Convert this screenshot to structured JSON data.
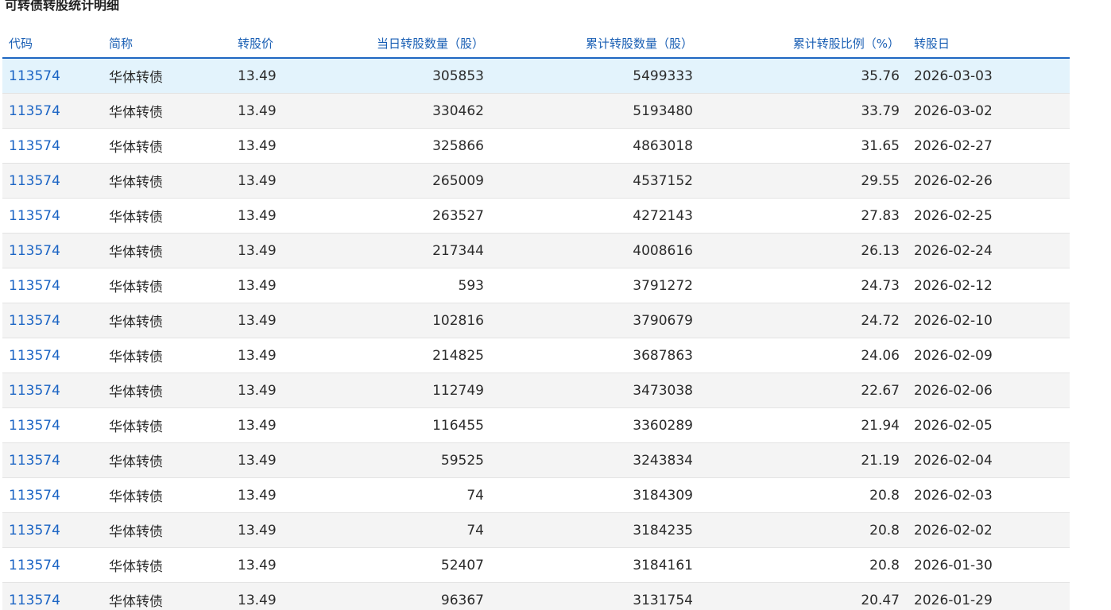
{
  "section_title": "可转债转股统计明细",
  "columns": {
    "code": "代码",
    "name": "简称",
    "price": "转股价",
    "daily": "当日转股数量（股）",
    "cumulative": "累计转股数量（股）",
    "ratio": "累计转股比例（%）",
    "date": "转股日"
  },
  "rows": [
    {
      "code": "113574",
      "name": "华体转债",
      "price": "13.49",
      "daily": "305853",
      "cumulative": "5499333",
      "ratio": "35.76",
      "date": "2026-03-03"
    },
    {
      "code": "113574",
      "name": "华体转债",
      "price": "13.49",
      "daily": "330462",
      "cumulative": "5193480",
      "ratio": "33.79",
      "date": "2026-03-02"
    },
    {
      "code": "113574",
      "name": "华体转债",
      "price": "13.49",
      "daily": "325866",
      "cumulative": "4863018",
      "ratio": "31.65",
      "date": "2026-02-27"
    },
    {
      "code": "113574",
      "name": "华体转债",
      "price": "13.49",
      "daily": "265009",
      "cumulative": "4537152",
      "ratio": "29.55",
      "date": "2026-02-26"
    },
    {
      "code": "113574",
      "name": "华体转债",
      "price": "13.49",
      "daily": "263527",
      "cumulative": "4272143",
      "ratio": "27.83",
      "date": "2026-02-25"
    },
    {
      "code": "113574",
      "name": "华体转债",
      "price": "13.49",
      "daily": "217344",
      "cumulative": "4008616",
      "ratio": "26.13",
      "date": "2026-02-24"
    },
    {
      "code": "113574",
      "name": "华体转债",
      "price": "13.49",
      "daily": "593",
      "cumulative": "3791272",
      "ratio": "24.73",
      "date": "2026-02-12"
    },
    {
      "code": "113574",
      "name": "华体转债",
      "price": "13.49",
      "daily": "102816",
      "cumulative": "3790679",
      "ratio": "24.72",
      "date": "2026-02-10"
    },
    {
      "code": "113574",
      "name": "华体转债",
      "price": "13.49",
      "daily": "214825",
      "cumulative": "3687863",
      "ratio": "24.06",
      "date": "2026-02-09"
    },
    {
      "code": "113574",
      "name": "华体转债",
      "price": "13.49",
      "daily": "112749",
      "cumulative": "3473038",
      "ratio": "22.67",
      "date": "2026-02-06"
    },
    {
      "code": "113574",
      "name": "华体转债",
      "price": "13.49",
      "daily": "116455",
      "cumulative": "3360289",
      "ratio": "21.94",
      "date": "2026-02-05"
    },
    {
      "code": "113574",
      "name": "华体转债",
      "price": "13.49",
      "daily": "59525",
      "cumulative": "3243834",
      "ratio": "21.19",
      "date": "2026-02-04"
    },
    {
      "code": "113574",
      "name": "华体转债",
      "price": "13.49",
      "daily": "74",
      "cumulative": "3184309",
      "ratio": "20.8",
      "date": "2026-02-03"
    },
    {
      "code": "113574",
      "name": "华体转债",
      "price": "13.49",
      "daily": "74",
      "cumulative": "3184235",
      "ratio": "20.8",
      "date": "2026-02-02"
    },
    {
      "code": "113574",
      "name": "华体转债",
      "price": "13.49",
      "daily": "52407",
      "cumulative": "3184161",
      "ratio": "20.8",
      "date": "2026-01-30"
    },
    {
      "code": "113574",
      "name": "华体转债",
      "price": "13.49",
      "daily": "96367",
      "cumulative": "3131754",
      "ratio": "20.47",
      "date": "2026-01-29"
    }
  ],
  "colors": {
    "link": "#1b64c4",
    "header_text": "#1a5fb4",
    "header_border": "#1f67c2",
    "highlight_row": "#e3f3fc",
    "stripe_row": "#f4f4f4"
  }
}
